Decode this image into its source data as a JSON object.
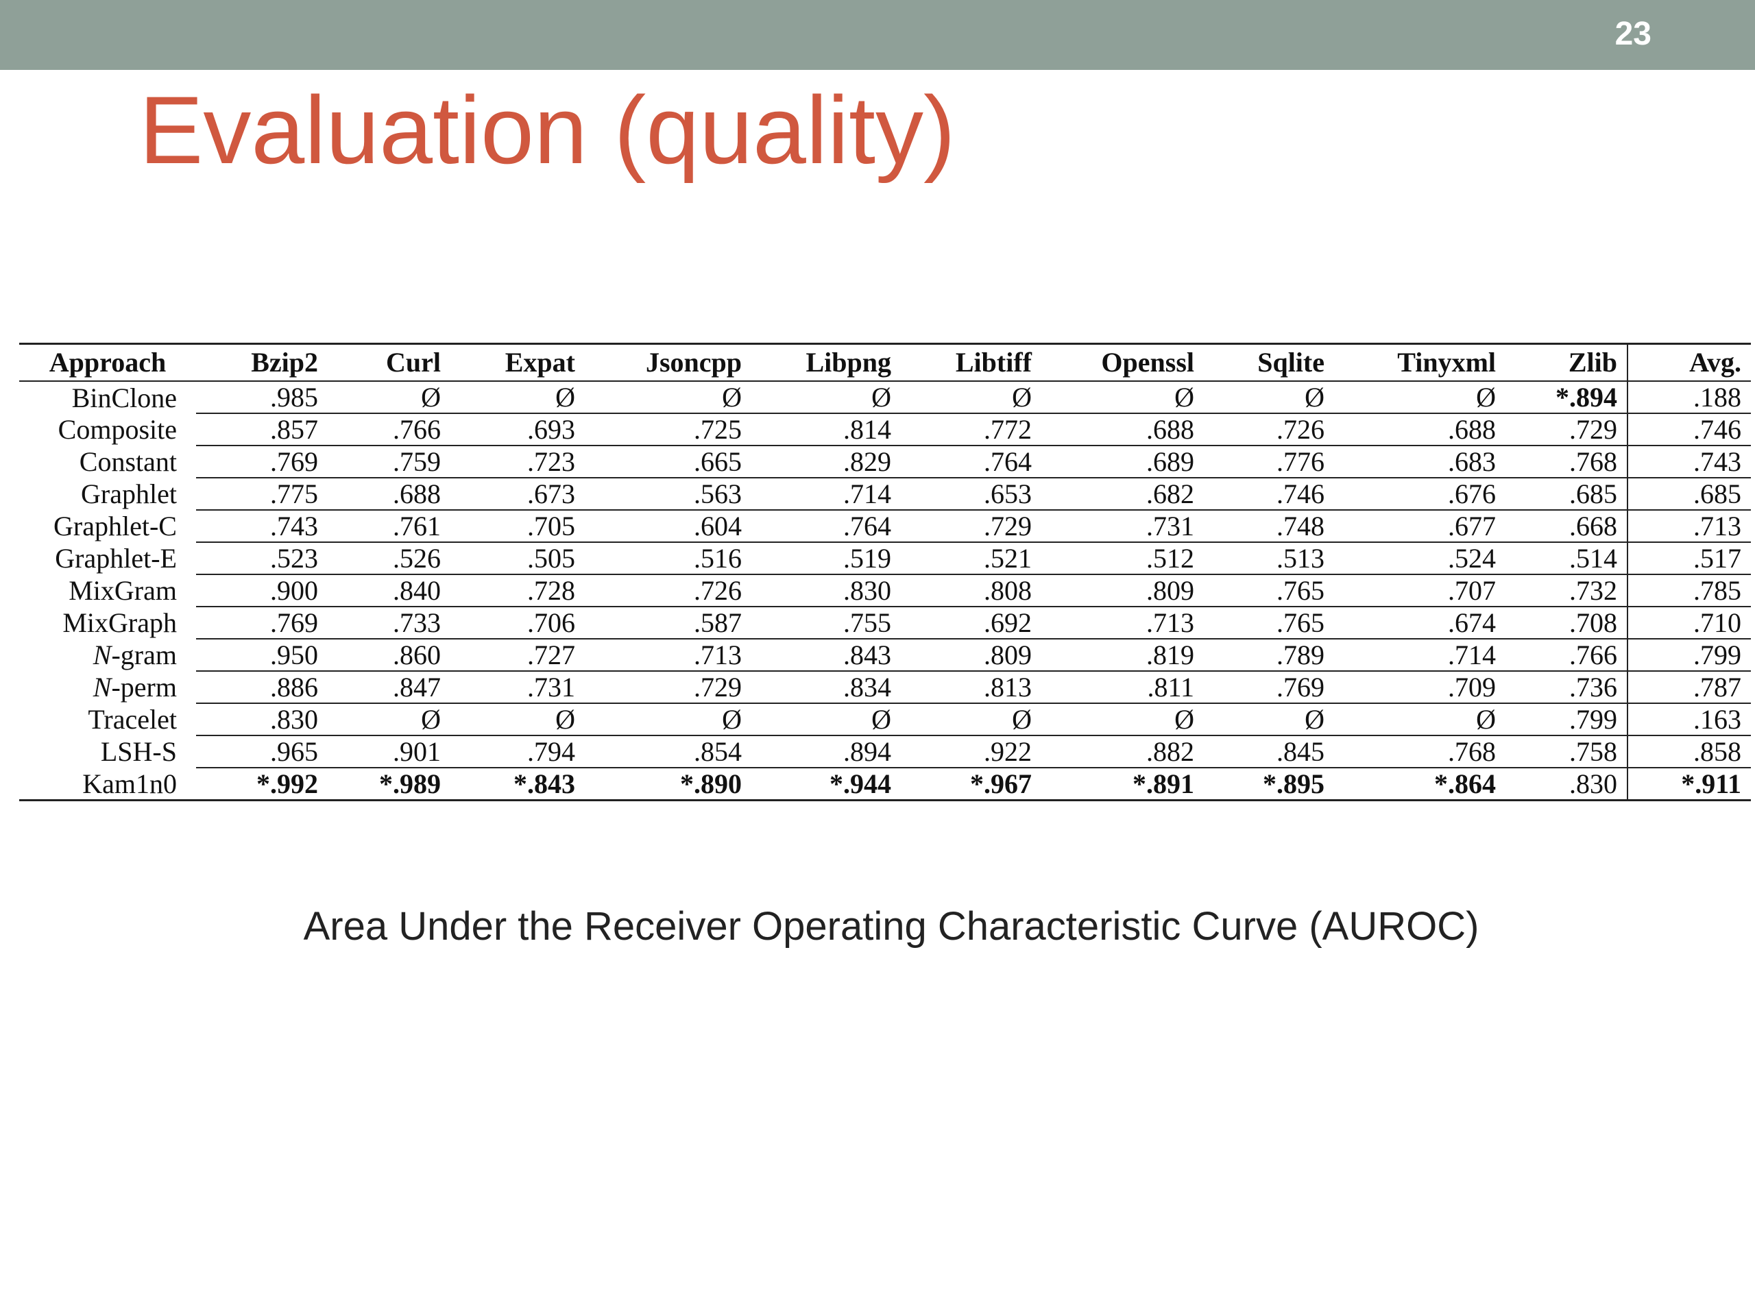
{
  "slide": {
    "number": "23",
    "title": "Evaluation (quality)"
  },
  "table": {
    "headers": [
      "Approach",
      "Bzip2",
      "Curl",
      "Expat",
      "Jsoncpp",
      "Libpng",
      "Libtiff",
      "Openssl",
      "Sqlite",
      "Tinyxml",
      "Zlib",
      "Avg."
    ],
    "rows": [
      {
        "approach": "BinClone",
        "values": [
          ".985",
          "Ø",
          "Ø",
          "Ø",
          "Ø",
          "Ø",
          "Ø",
          "Ø",
          "Ø",
          "*.894",
          ".188"
        ],
        "bold": [
          false,
          false,
          false,
          false,
          false,
          false,
          false,
          false,
          false,
          true,
          false
        ]
      },
      {
        "approach": "Composite",
        "values": [
          ".857",
          ".766",
          ".693",
          ".725",
          ".814",
          ".772",
          ".688",
          ".726",
          ".688",
          ".729",
          ".746"
        ],
        "bold": [
          false,
          false,
          false,
          false,
          false,
          false,
          false,
          false,
          false,
          false,
          false
        ]
      },
      {
        "approach": "Constant",
        "values": [
          ".769",
          ".759",
          ".723",
          ".665",
          ".829",
          ".764",
          ".689",
          ".776",
          ".683",
          ".768",
          ".743"
        ],
        "bold": [
          false,
          false,
          false,
          false,
          false,
          false,
          false,
          false,
          false,
          false,
          false
        ]
      },
      {
        "approach": "Graphlet",
        "values": [
          ".775",
          ".688",
          ".673",
          ".563",
          ".714",
          ".653",
          ".682",
          ".746",
          ".676",
          ".685",
          ".685"
        ],
        "bold": [
          false,
          false,
          false,
          false,
          false,
          false,
          false,
          false,
          false,
          false,
          false
        ]
      },
      {
        "approach": "Graphlet-C",
        "values": [
          ".743",
          ".761",
          ".705",
          ".604",
          ".764",
          ".729",
          ".731",
          ".748",
          ".677",
          ".668",
          ".713"
        ],
        "bold": [
          false,
          false,
          false,
          false,
          false,
          false,
          false,
          false,
          false,
          false,
          false
        ]
      },
      {
        "approach": "Graphlet-E",
        "values": [
          ".523",
          ".526",
          ".505",
          ".516",
          ".519",
          ".521",
          ".512",
          ".513",
          ".524",
          ".514",
          ".517"
        ],
        "bold": [
          false,
          false,
          false,
          false,
          false,
          false,
          false,
          false,
          false,
          false,
          false
        ]
      },
      {
        "approach": "MixGram",
        "values": [
          ".900",
          ".840",
          ".728",
          ".726",
          ".830",
          ".808",
          ".809",
          ".765",
          ".707",
          ".732",
          ".785"
        ],
        "bold": [
          false,
          false,
          false,
          false,
          false,
          false,
          false,
          false,
          false,
          false,
          false
        ]
      },
      {
        "approach": "MixGraph",
        "values": [
          ".769",
          ".733",
          ".706",
          ".587",
          ".755",
          ".692",
          ".713",
          ".765",
          ".674",
          ".708",
          ".710"
        ],
        "bold": [
          false,
          false,
          false,
          false,
          false,
          false,
          false,
          false,
          false,
          false,
          false
        ]
      },
      {
        "approach": "N-gram",
        "values": [
          ".950",
          ".860",
          ".727",
          ".713",
          ".843",
          ".809",
          ".819",
          ".789",
          ".714",
          ".766",
          ".799"
        ],
        "bold": [
          false,
          false,
          false,
          false,
          false,
          false,
          false,
          false,
          false,
          false,
          false
        ]
      },
      {
        "approach": "N-perm",
        "values": [
          ".886",
          ".847",
          ".731",
          ".729",
          ".834",
          ".813",
          ".811",
          ".769",
          ".709",
          ".736",
          ".787"
        ],
        "bold": [
          false,
          false,
          false,
          false,
          false,
          false,
          false,
          false,
          false,
          false,
          false
        ]
      },
      {
        "approach": "Tracelet",
        "values": [
          ".830",
          "Ø",
          "Ø",
          "Ø",
          "Ø",
          "Ø",
          "Ø",
          "Ø",
          "Ø",
          ".799",
          ".163"
        ],
        "bold": [
          false,
          false,
          false,
          false,
          false,
          false,
          false,
          false,
          false,
          false,
          false
        ]
      },
      {
        "approach": "LSH-S",
        "values": [
          ".965",
          ".901",
          ".794",
          ".854",
          ".894",
          ".922",
          ".882",
          ".845",
          ".768",
          ".758",
          ".858"
        ],
        "bold": [
          false,
          false,
          false,
          false,
          false,
          false,
          false,
          false,
          false,
          false,
          false
        ]
      },
      {
        "approach": "Kam1n0",
        "values": [
          "*.992",
          "*.989",
          "*.843",
          "*.890",
          "*.944",
          "*.967",
          "*.891",
          "*.895",
          "*.864",
          ".830",
          "*.911"
        ],
        "bold": [
          true,
          true,
          true,
          true,
          true,
          true,
          true,
          true,
          true,
          false,
          true
        ]
      }
    ]
  },
  "caption": "Area Under the Receiver Operating Characteristic Curve (AUROC)"
}
